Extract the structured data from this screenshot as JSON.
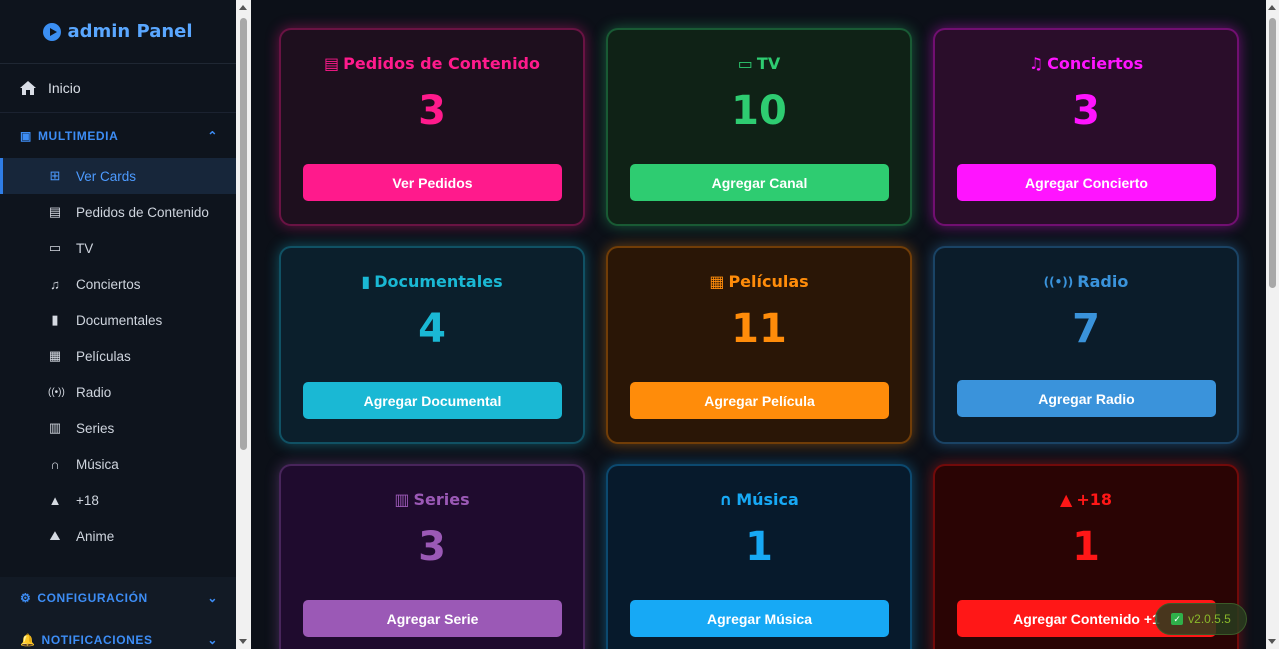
{
  "brand": {
    "name": "admin Panel"
  },
  "sidebar": {
    "home_label": "Inicio",
    "multimedia_label": "MULTIMEDIA",
    "items": [
      {
        "label": "Ver Cards",
        "icon": "grid-icon"
      },
      {
        "label": "Pedidos de Contenido",
        "icon": "clipboard-icon"
      },
      {
        "label": "TV",
        "icon": "tv-icon"
      },
      {
        "label": "Conciertos",
        "icon": "music-note-icon"
      },
      {
        "label": "Documentales",
        "icon": "book-icon"
      },
      {
        "label": "Películas",
        "icon": "clapperboard-icon"
      },
      {
        "label": "Radio",
        "icon": "broadcast-icon"
      },
      {
        "label": "Series",
        "icon": "film-icon"
      },
      {
        "label": "Música",
        "icon": "headphones-icon"
      },
      {
        "label": "+18",
        "icon": "warning-icon"
      },
      {
        "label": "Anime",
        "icon": "anime-icon"
      }
    ],
    "config_label": "CONFIGURACIÓN",
    "notif_label": "NOTIFICACIONES"
  },
  "cards": [
    {
      "title": "Pedidos de Contenido",
      "count": "3",
      "button": "Ver Pedidos",
      "color": "#ff1a8c",
      "bg": "#1e0f1e",
      "icon": "clipboard-icon"
    },
    {
      "title": "TV",
      "count": "10",
      "button": "Agregar Canal",
      "color": "#2ecc71",
      "bg": "#0f2216",
      "icon": "tv-icon"
    },
    {
      "title": "Conciertos",
      "count": "3",
      "button": "Agregar Concierto",
      "color": "#ff14ff",
      "bg": "#2a0d2a",
      "icon": "music-note-icon"
    },
    {
      "title": "Documentales",
      "count": "4",
      "button": "Agregar Documental",
      "color": "#1ab8d4",
      "bg": "#0b1f2c",
      "icon": "book-icon"
    },
    {
      "title": "Películas",
      "count": "11",
      "button": "Agregar Película",
      "color": "#ff8c0a",
      "bg": "#2a1606",
      "icon": "clapperboard-icon"
    },
    {
      "title": "Radio",
      "count": "7",
      "button": "Agregar Radio",
      "color": "#3a93db",
      "bg": "#0b1c2a",
      "icon": "broadcast-icon"
    },
    {
      "title": "Series",
      "count": "3",
      "button": "Agregar Serie",
      "color": "#9b59b6",
      "bg": "#1f0b2e",
      "icon": "film-icon"
    },
    {
      "title": "Música",
      "count": "1",
      "button": "Agregar Música",
      "color": "#17a9f5",
      "bg": "#071a2c",
      "icon": "headphones-icon"
    },
    {
      "title": "+18",
      "count": "1",
      "button": "Agregar Contenido +1",
      "color": "#ff1717",
      "bg": "#2a0404",
      "icon": "warning-icon"
    }
  ],
  "version": "v2.0.5.5"
}
